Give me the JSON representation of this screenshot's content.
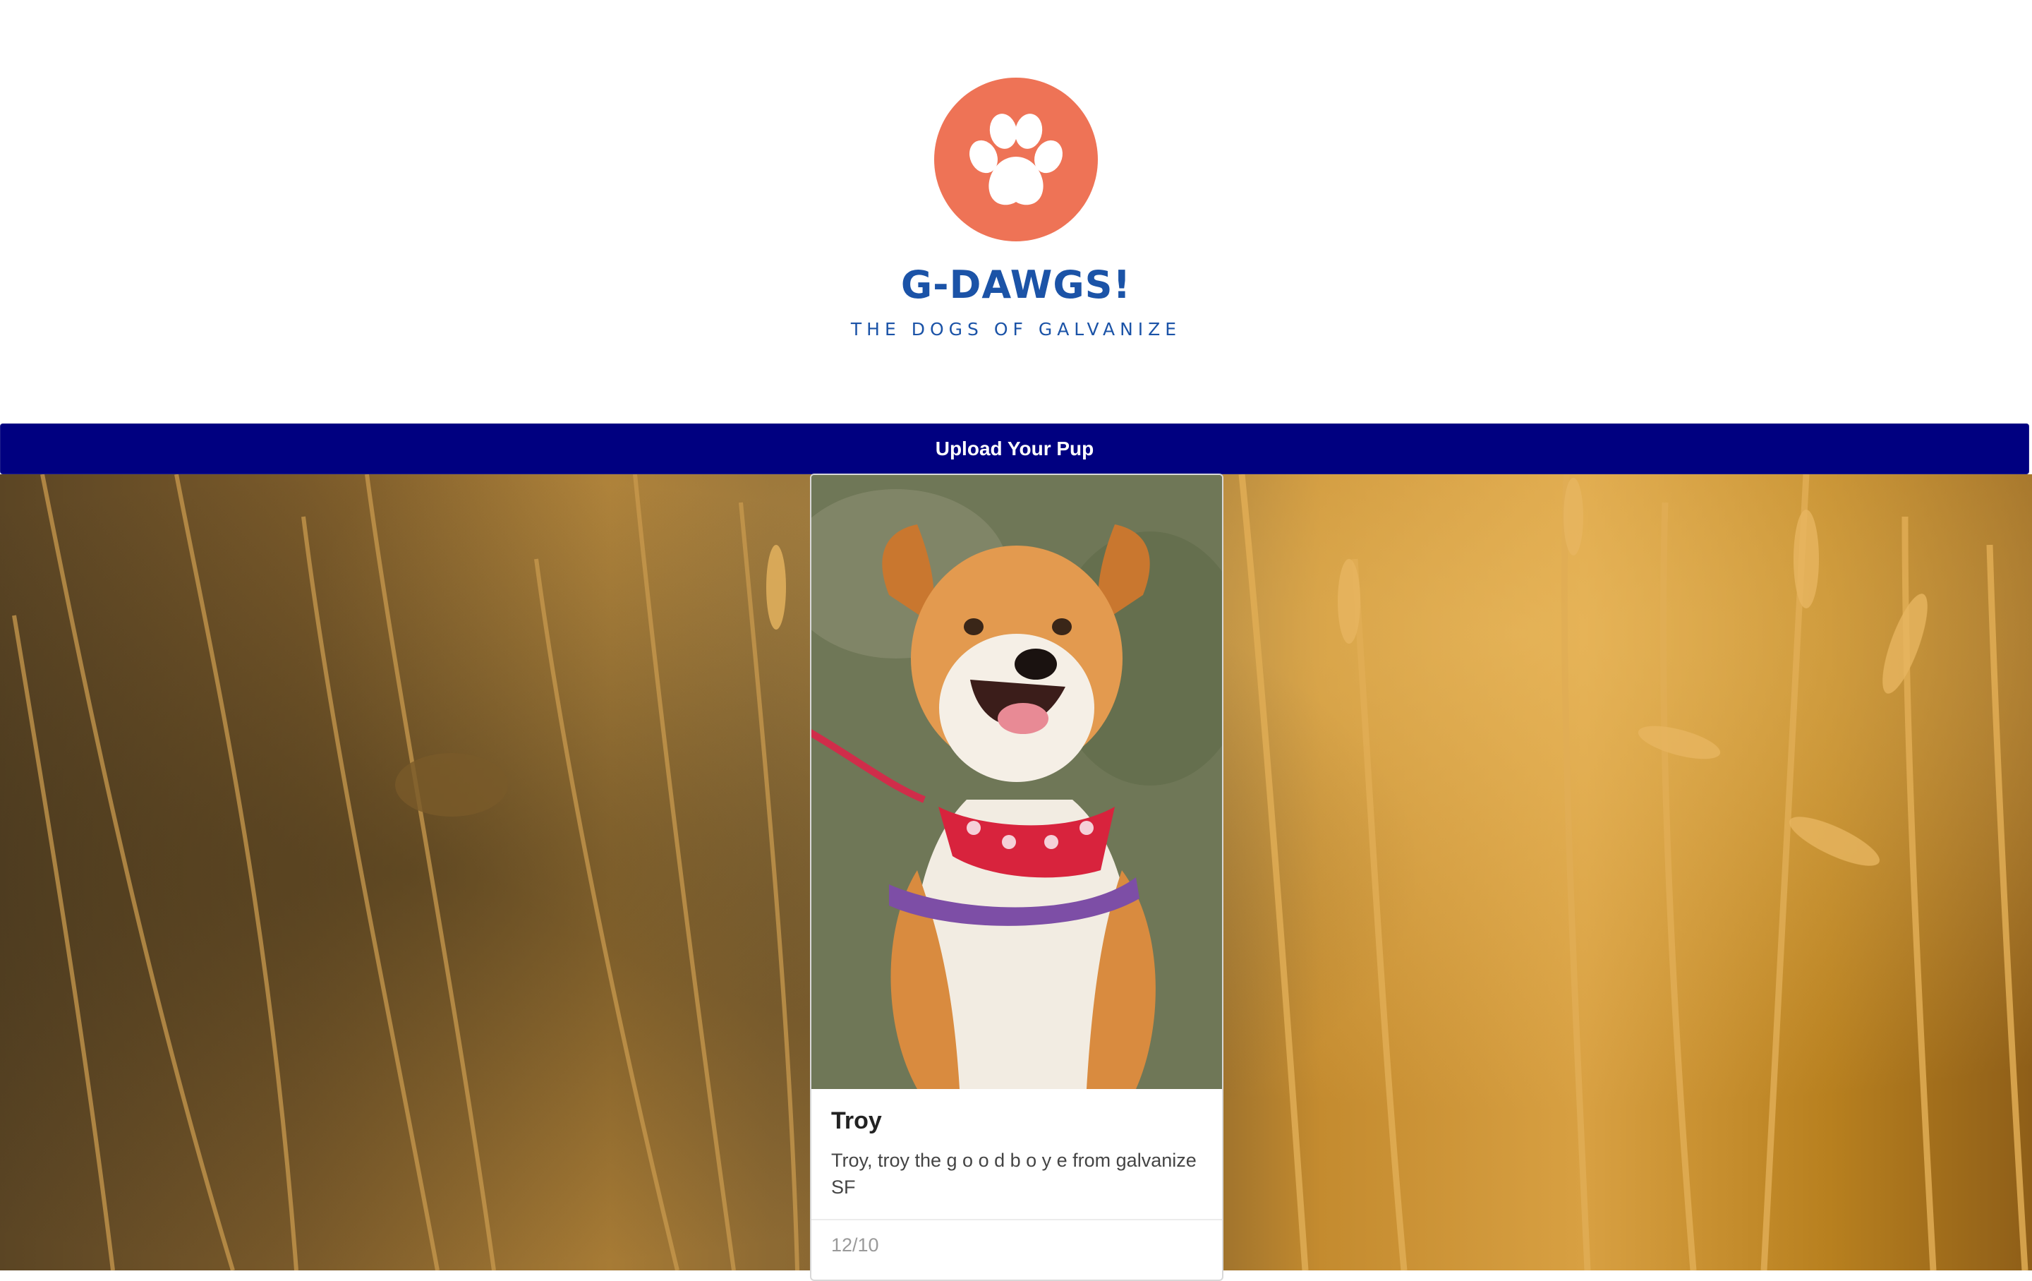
{
  "brand": {
    "title": "G-DAWGS!",
    "tagline": "THE DOGS OF GALVANIZE",
    "logo_icon": "paw-icon",
    "logo_color": "#ee7356",
    "text_color": "#1b53a7"
  },
  "upload": {
    "label": "Upload Your Pup",
    "color": "#000080"
  },
  "background": {
    "image": "golden-wheat-field-photo"
  },
  "cards": [
    {
      "image": "smiling-dog-with-red-bandana-photo",
      "name": "Troy",
      "description": "Troy, troy the g o o d b o y e from galvanize SF",
      "rating": "12/10"
    }
  ]
}
